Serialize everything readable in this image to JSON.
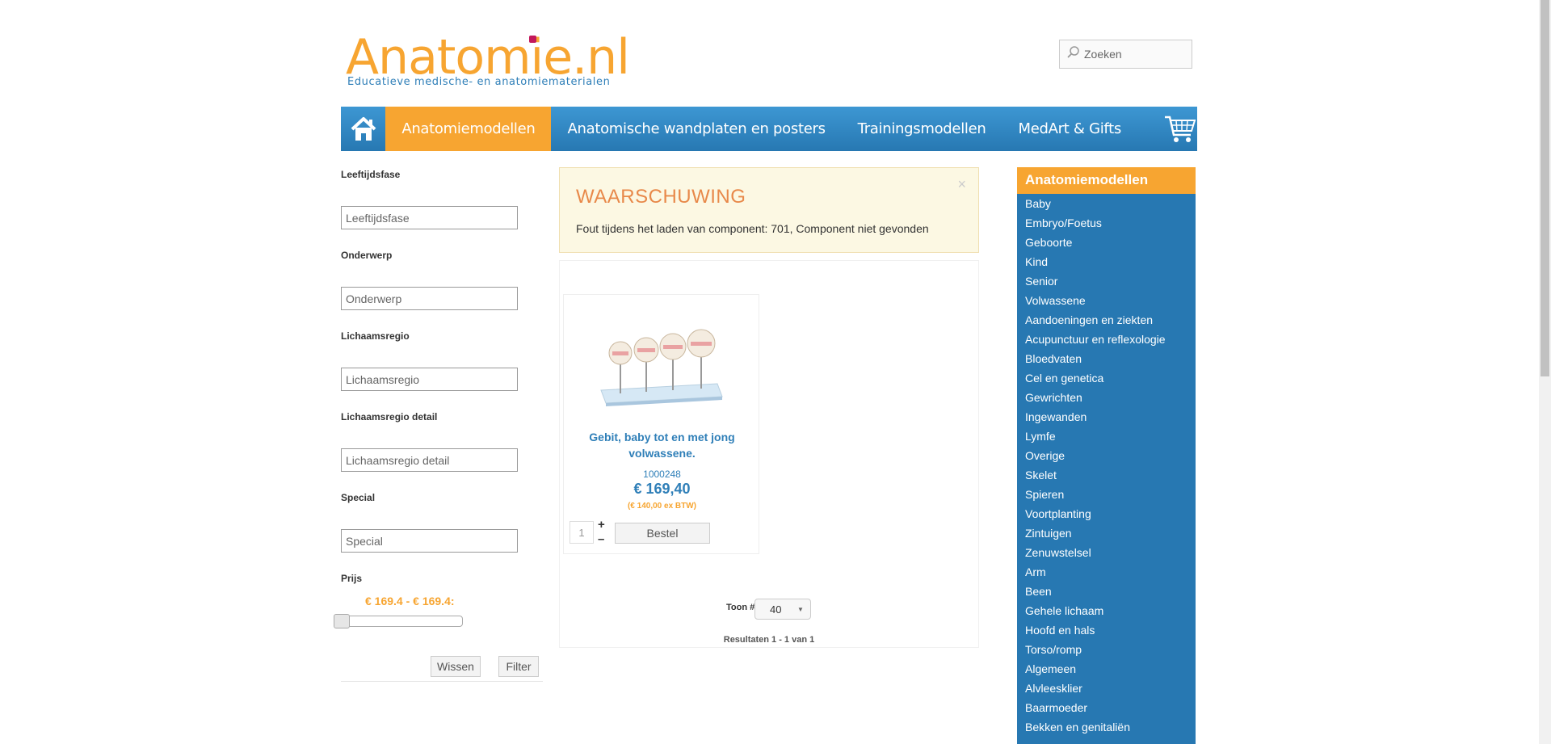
{
  "header": {
    "logo_text": "Anatomie.nl",
    "logo_tagline": "Educatieve medische- en anatomiematerialen",
    "search_placeholder": "Zoeken"
  },
  "nav": {
    "items": [
      {
        "label": "Anatomiemodellen"
      },
      {
        "label": "Anatomische wandplaten en posters"
      },
      {
        "label": "Trainingsmodellen"
      },
      {
        "label": "MedArt & Gifts"
      }
    ],
    "home_icon": "home-icon",
    "cart_icon": "cart-icon"
  },
  "filters": {
    "leeftijdsfase": {
      "label": "Leeftijdsfase",
      "placeholder": "Leeftijdsfase"
    },
    "onderwerp": {
      "label": "Onderwerp",
      "placeholder": "Onderwerp"
    },
    "lichaamsregio": {
      "label": "Lichaamsregio",
      "placeholder": "Lichaamsregio"
    },
    "lichaamsregio_detail": {
      "label": "Lichaamsregio detail",
      "placeholder": "Lichaamsregio detail"
    },
    "special": {
      "label": "Special",
      "placeholder": "Special"
    },
    "prijs": {
      "label": "Prijs",
      "range": "€ 169.4 - € 169.4:"
    },
    "clear_label": "Wissen",
    "filter_label": "Filter"
  },
  "alert": {
    "title": "WAARSCHUWING",
    "message": "Fout tijdens het laden van component: 701, Component niet gevonden",
    "close": "×"
  },
  "product": {
    "name": "Gebit, baby tot en met jong volwassene.",
    "sku": "1000248",
    "price": "€ 169,40",
    "price_ex": "(€ 140,00 ex BTW)",
    "quantity": "1",
    "plus": "+",
    "minus": "–",
    "order_label": "Bestel"
  },
  "pagination": {
    "show_label": "Toon #",
    "show_value": "40",
    "results": "Resultaten 1 - 1 van 1"
  },
  "categories": {
    "title": "Anatomiemodellen",
    "items": [
      "Baby",
      "Embryo/Foetus",
      "Geboorte",
      "Kind",
      "Senior",
      "Volwassene",
      "Aandoeningen en ziekten",
      "Acupunctuur en reflexologie",
      "Bloedvaten",
      "Cel en genetica",
      "Gewrichten",
      "Ingewanden",
      "Lymfe",
      "Overige",
      "Skelet",
      "Spieren",
      "Voortplanting",
      "Zintuigen",
      "Zenuwstelsel",
      "Arm",
      "Been",
      "Gehele lichaam",
      "Hoofd en hals",
      "Torso/romp",
      "Algemeen",
      "Alvleesklier",
      "Baarmoeder",
      "Bekken en genitaliën"
    ]
  },
  "colors": {
    "brand_orange": "#f7a531",
    "brand_blue": "#2778b2",
    "alert_bg": "#fcf8e3",
    "alert_title": "#e8894a"
  }
}
